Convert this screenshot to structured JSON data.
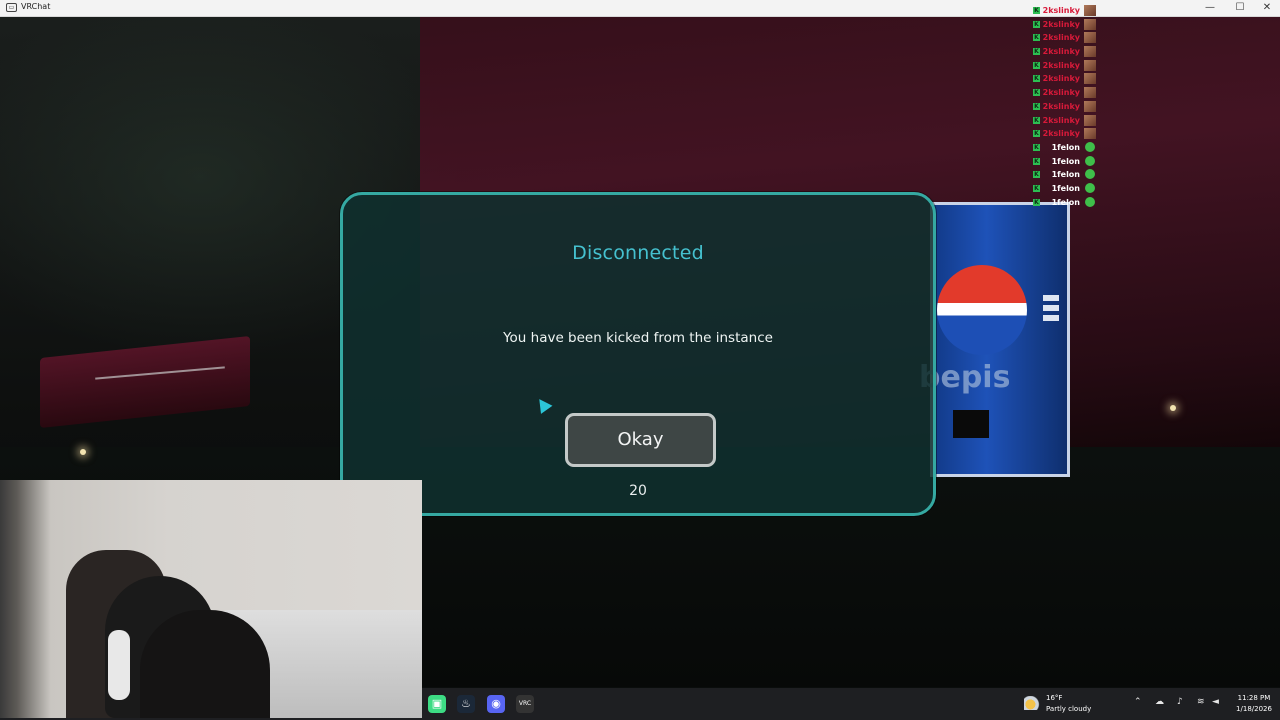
{
  "window": {
    "title": "VRChat",
    "controls": {
      "minimize": "—",
      "maximize": "☐",
      "close": "✕"
    }
  },
  "kicked_list": [
    {
      "name": "2kslinky",
      "color": "#d81a3a",
      "avatar": "face"
    },
    {
      "name": "2kslinky",
      "color": "#d81a3a",
      "avatar": "face"
    },
    {
      "name": "2kslinky",
      "color": "#d81a3a",
      "avatar": "face"
    },
    {
      "name": "2kslinky",
      "color": "#d81a3a",
      "avatar": "face"
    },
    {
      "name": "2kslinky",
      "color": "#d81a3a",
      "avatar": "face"
    },
    {
      "name": "2kslinky",
      "color": "#d81a3a",
      "avatar": "face"
    },
    {
      "name": "2kslinky",
      "color": "#d81a3a",
      "avatar": "face"
    },
    {
      "name": "2kslinky",
      "color": "#d81a3a",
      "avatar": "face"
    },
    {
      "name": "2kslinky",
      "color": "#d81a3a",
      "avatar": "face"
    },
    {
      "name": "2kslinky",
      "color": "#d81a3a",
      "avatar": "face"
    },
    {
      "name": "1felon",
      "color": "#ffffff",
      "avatar": "green"
    },
    {
      "name": "1felon",
      "color": "#ffffff",
      "avatar": "green"
    },
    {
      "name": "1felon",
      "color": "#ffffff",
      "avatar": "green"
    },
    {
      "name": "1felon",
      "color": "#ffffff",
      "avatar": "green"
    },
    {
      "name": "1felon",
      "color": "#ffffff",
      "avatar": "green"
    }
  ],
  "kick_icon_glyph": "K",
  "dialog": {
    "title": "Disconnected",
    "message": "You have been kicked from the instance",
    "ok_label": "Okay",
    "countdown": "20",
    "accent": "#35a9a2"
  },
  "scene": {
    "vending_brand": "bepis"
  },
  "taskbar": {
    "apps": [
      {
        "name": "android-app-icon",
        "glyph": "▣",
        "color": "#3ddc84"
      },
      {
        "name": "steam-icon",
        "glyph": "♨",
        "color": "#1b2838"
      },
      {
        "name": "discord-icon",
        "glyph": "◉",
        "color": "#5865f2"
      },
      {
        "name": "vrchat-icon",
        "glyph": "VRC",
        "color": "#333333"
      }
    ],
    "weather": {
      "temp": "16°F",
      "condition": "Partly cloudy"
    },
    "tray_icons": [
      "chevron-up-icon",
      "network-cloud-icon",
      "microphone-icon",
      "wifi-icon",
      "speaker-icon"
    ],
    "clock": {
      "time": "11:28 PM",
      "date": "1/18/2026"
    }
  }
}
